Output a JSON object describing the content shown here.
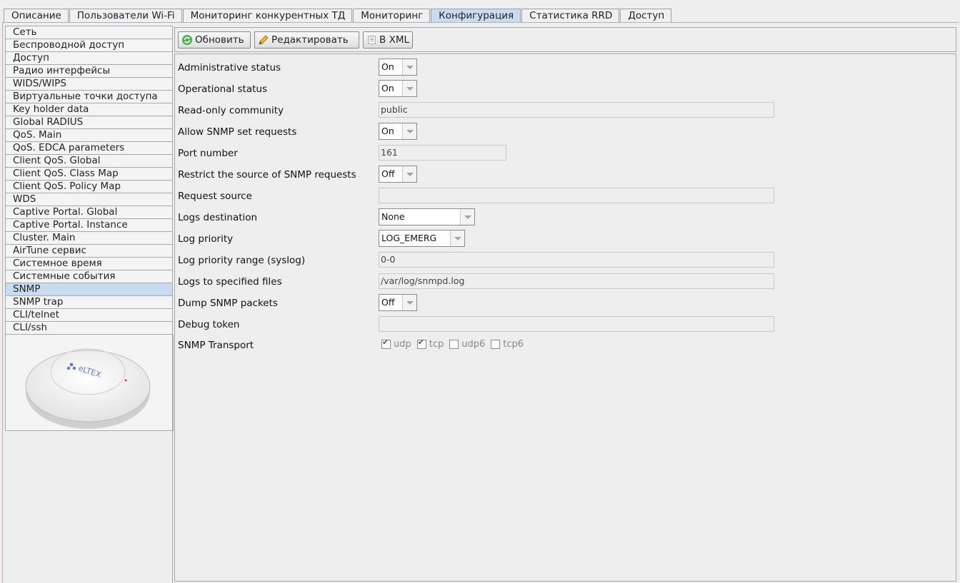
{
  "tabs": [
    {
      "label": "Описание",
      "active": false
    },
    {
      "label": "Пользователи Wi-Fi",
      "active": false
    },
    {
      "label": "Мониторинг конкурентных ТД",
      "active": false
    },
    {
      "label": "Мониторинг",
      "active": false
    },
    {
      "label": "Конфигурация",
      "active": true
    },
    {
      "label": "Статистика RRD",
      "active": false
    },
    {
      "label": "Доступ",
      "active": false
    }
  ],
  "sidebar": {
    "selected": "SNMP",
    "items": [
      "Сеть",
      "Беспроводной доступ",
      "Доступ",
      "Радио интерфейсы",
      "WIDS/WIPS",
      "Виртуальные точки доступа",
      "Key holder data",
      "Global RADIUS",
      "QoS. Main",
      "QoS. EDCA parameters",
      "Client QoS. Global",
      "Client QoS. Class Map",
      "Client QoS. Policy Map",
      "WDS",
      "Captive Portal. Global",
      "Captive Portal. Instance",
      "Cluster. Main",
      "AirTune сервис",
      "Системное время",
      "Системные события",
      "SNMP",
      "SNMP trap",
      "CLI/telnet",
      "CLI/ssh"
    ],
    "device_logo": "eltex"
  },
  "toolbar": {
    "refresh_label": "Обновить",
    "edit_label": "Редактировать",
    "xml_label": "В XML"
  },
  "form": {
    "admin_status": {
      "label": "Administrative status",
      "value": "On"
    },
    "oper_status": {
      "label": "Operational status",
      "value": "On"
    },
    "ro_community": {
      "label": "Read-only community",
      "value": "public"
    },
    "allow_set": {
      "label": "Allow SNMP set requests",
      "value": "On"
    },
    "port": {
      "label": "Port number",
      "value": "161"
    },
    "restrict_source": {
      "label": "Restrict the source of SNMP requests",
      "value": "Off"
    },
    "request_source": {
      "label": "Request source",
      "value": ""
    },
    "logs_dest": {
      "label": "Logs destination",
      "value": "None"
    },
    "log_priority": {
      "label": "Log priority",
      "value": "LOG_EMERG"
    },
    "log_range": {
      "label": "Log priority range (syslog)",
      "value": "0-0"
    },
    "log_files": {
      "label": "Logs to specified files",
      "value": "/var/log/snmpd.log"
    },
    "dump_packets": {
      "label": "Dump SNMP packets",
      "value": "Off"
    },
    "debug_token": {
      "label": "Debug token",
      "value": ""
    },
    "transport": {
      "label": "SNMP Transport",
      "options": [
        {
          "label": "udp",
          "checked": true
        },
        {
          "label": "tcp",
          "checked": true
        },
        {
          "label": "udp6",
          "checked": false
        },
        {
          "label": "tcp6",
          "checked": false
        }
      ]
    }
  },
  "colors": {
    "selected": "#c9dcef",
    "background": "#eeeeee"
  }
}
